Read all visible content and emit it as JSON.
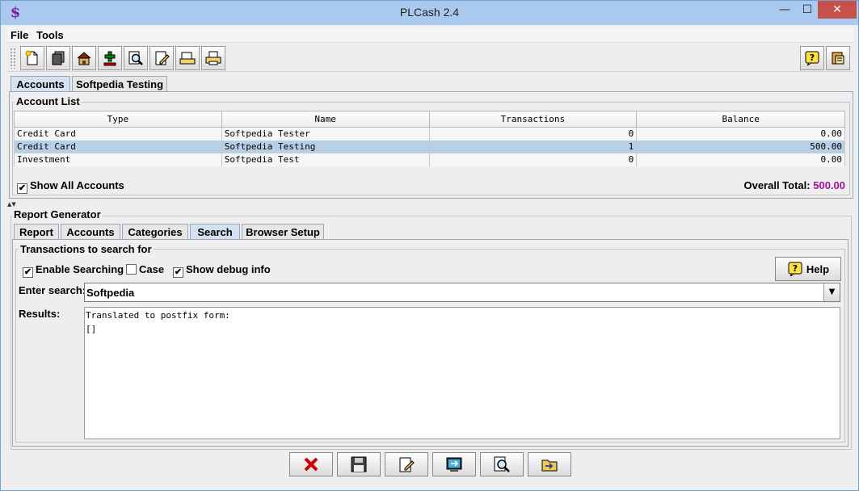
{
  "window": {
    "title": "PLCash 2.4",
    "app_icon": "$",
    "min_glyph": "—",
    "max_glyph": "☐",
    "close_glyph": "✕"
  },
  "menu": {
    "items": [
      "File",
      "Tools"
    ]
  },
  "toolbar": {
    "icons": [
      "new-file-icon",
      "documents-icon",
      "home-icon",
      "add-icon",
      "search-icon",
      "edit-icon",
      "open-icon",
      "print-icon"
    ],
    "right_icons": [
      "help-icon",
      "exit-icon"
    ]
  },
  "top_tabs": [
    "Accounts",
    "Softpedia Testing"
  ],
  "account_list": {
    "label": "Account List",
    "columns": [
      "Type",
      "Name",
      "Transactions",
      "Balance"
    ],
    "rows": [
      {
        "type": "Credit Card",
        "name": "Softpedia Tester",
        "transactions": "0",
        "balance": "0.00"
      },
      {
        "type": "Credit Card",
        "name": "Softpedia Testing",
        "transactions": "1",
        "balance": "500.00"
      },
      {
        "type": "Investment",
        "name": "Softpedia Test",
        "transactions": "0",
        "balance": "0.00"
      }
    ],
    "selected_row": 1,
    "show_all": {
      "label": "Show All Accounts",
      "checked": true
    },
    "overall_total_label": "Overall Total:",
    "overall_total_value": "500.00"
  },
  "report": {
    "label": "Report Generator",
    "tabs": [
      "Report",
      "Accounts",
      "Categories",
      "Search",
      "Browser Setup"
    ],
    "selected_tab": 3,
    "section_label": "Transactions to search for",
    "enable_searching": {
      "label": "Enable Searching",
      "checked": true
    },
    "case": {
      "label": "Case",
      "checked": false
    },
    "show_debug": {
      "label": "Show debug info",
      "checked": true
    },
    "help_label": "Help",
    "enter_search_label": "Enter search:",
    "search_value": "Softpedia",
    "results_label": "Results:",
    "results_lines": [
      "Translated to postfix form:",
      "[]"
    ]
  },
  "bottom_buttons": [
    "delete-icon",
    "save-icon",
    "edit-icon",
    "export-icon",
    "search-icon",
    "open-folder-icon"
  ],
  "colors": {
    "total": "#a0119f",
    "selected_row": "#b8cfe6",
    "close": "#c7504a"
  }
}
